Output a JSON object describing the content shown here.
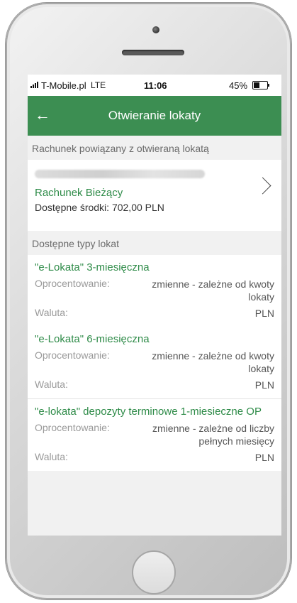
{
  "status_bar": {
    "carrier": "T-Mobile.pl",
    "network": "LTE",
    "time": "11:06",
    "battery_percent": "45%",
    "battery_level": 0.45
  },
  "app_bar": {
    "title": "Otwieranie lokaty",
    "back_icon": "arrow-left-icon"
  },
  "account_section": {
    "header": "Rachunek powiązany z otwieraną lokatą",
    "account": {
      "name": "Rachunek Bieżący",
      "available": "Dostępne środki: 702,00 PLN",
      "chevron_icon": "chevron-right-icon"
    }
  },
  "deposits_section": {
    "header": "Dostępne typy lokat",
    "items": [
      {
        "name": "\"e-Lokata\" 3-miesięczna",
        "interest_label": "Oprocentowanie:",
        "interest_value": "zmienne - zależne od kwoty lokaty",
        "currency_label": "Waluta:",
        "currency_value": "PLN"
      },
      {
        "name": "\"e-Lokata\" 6-miesięczna",
        "interest_label": "Oprocentowanie:",
        "interest_value": "zmienne - zależne od kwoty lokaty",
        "currency_label": "Waluta:",
        "currency_value": "PLN"
      },
      {
        "name": "\"e-lokata\" depozyty terminowe 1-miesieczne OP",
        "interest_label": "Oprocentowanie:",
        "interest_value": "zmienne - zależne od liczby pełnych miesięcy",
        "currency_label": "Waluta:",
        "currency_value": "PLN"
      }
    ]
  },
  "colors": {
    "brand_green": "#3c8e52",
    "link_green": "#2e8b48"
  }
}
